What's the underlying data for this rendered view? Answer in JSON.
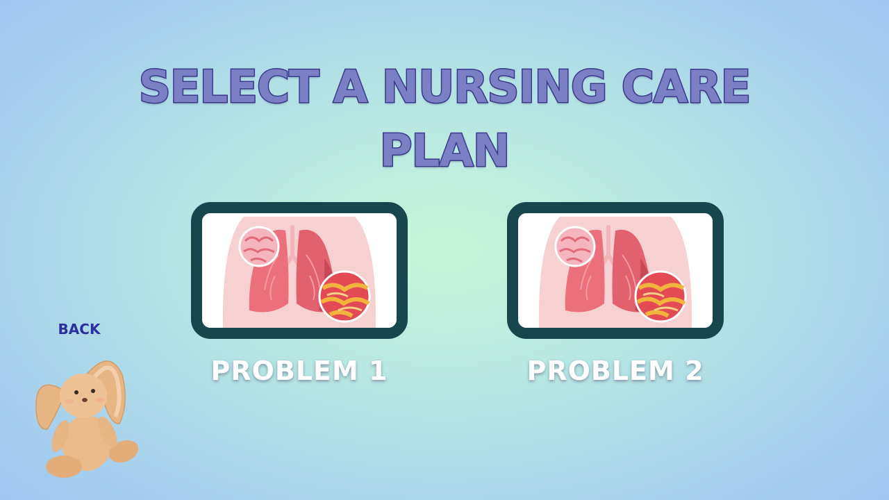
{
  "header": {
    "title": "SELECT A NURSING CARE PLAN"
  },
  "options": [
    {
      "label": "PROBLEM 1",
      "image": "lungs-illustration"
    },
    {
      "label": "PROBLEM 2",
      "image": "lungs-illustration"
    }
  ],
  "back": {
    "label": "BACK",
    "image": "bunny-plush-illustration"
  },
  "colors": {
    "card_border": "#17474d",
    "title_fill": "#7b7fc4",
    "title_stroke": "#3d3a8e",
    "back_text": "#2a2f9e"
  }
}
